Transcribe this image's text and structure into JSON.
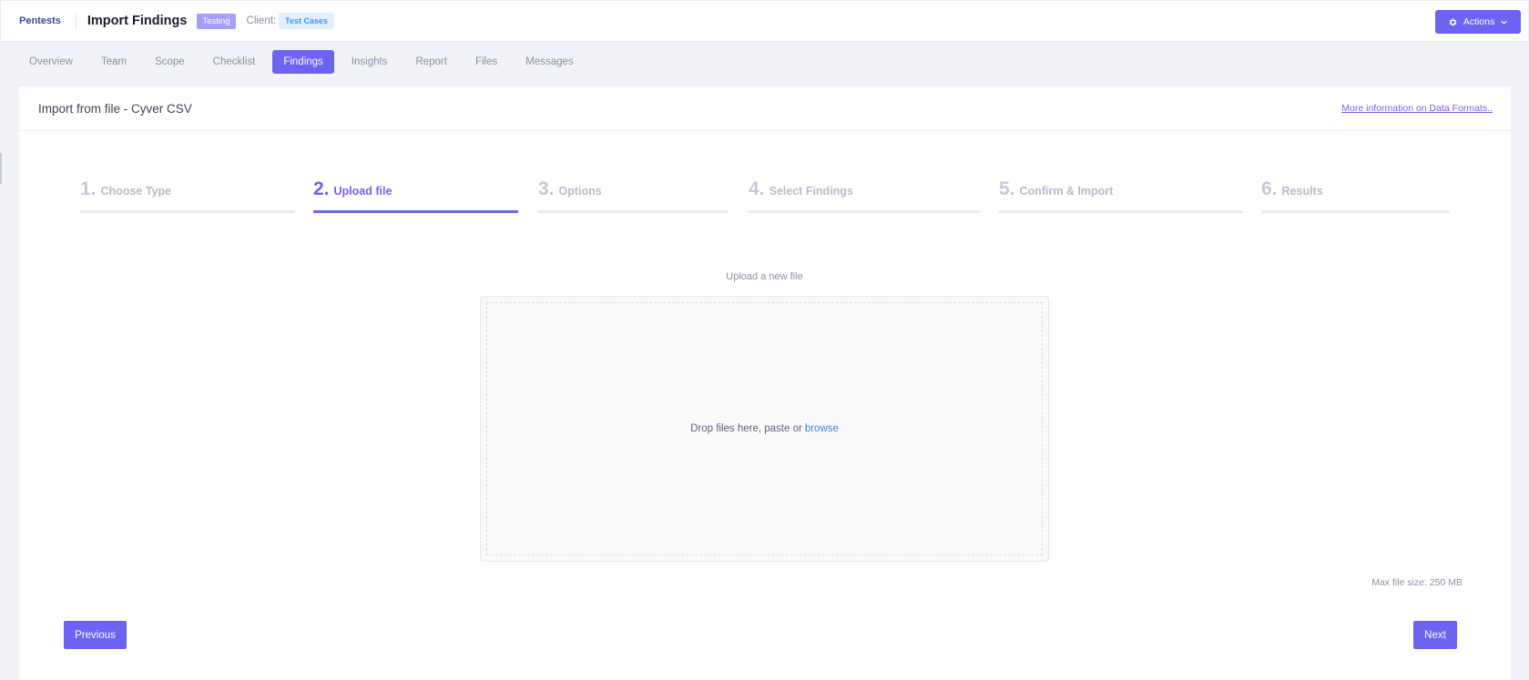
{
  "header": {
    "brand": "Pentests",
    "title": "Import Findings",
    "status_badge": "Testing",
    "client_label": "Client:",
    "client_name": "Test Cases",
    "actions_label": "Actions",
    "actions_icon": "gear-icon",
    "actions_caret_icon": "chevron-down-icon"
  },
  "tabs": [
    {
      "label": "Overview"
    },
    {
      "label": "Team"
    },
    {
      "label": "Scope"
    },
    {
      "label": "Checklist"
    },
    {
      "label": "Findings",
      "active": true
    },
    {
      "label": "Insights"
    },
    {
      "label": "Report"
    },
    {
      "label": "Files"
    },
    {
      "label": "Messages"
    }
  ],
  "card": {
    "title": "Import from file - Cyver CSV",
    "more_info_link": "More information on Data Formats.."
  },
  "steps": [
    {
      "num": "1.",
      "label": "Choose Type"
    },
    {
      "num": "2.",
      "label": "Upload file",
      "active": true
    },
    {
      "num": "3.",
      "label": "Options"
    },
    {
      "num": "4.",
      "label": "Select Findings"
    },
    {
      "num": "5.",
      "label": "Confirm & Import"
    },
    {
      "num": "6.",
      "label": "Results"
    }
  ],
  "upload": {
    "title": "Upload a new file",
    "drop_text": "Drop files here, paste or",
    "browse_text": "browse",
    "max_size": "Max file size: 250 MB"
  },
  "buttons": {
    "previous": "Previous",
    "next": "Next"
  },
  "colors": {
    "accent": "#6c63f2",
    "status_badge": "#a79ef7",
    "client_badge_bg": "#e1f0ff",
    "client_badge_text": "#3699ff",
    "link": "#3d7fd4"
  }
}
